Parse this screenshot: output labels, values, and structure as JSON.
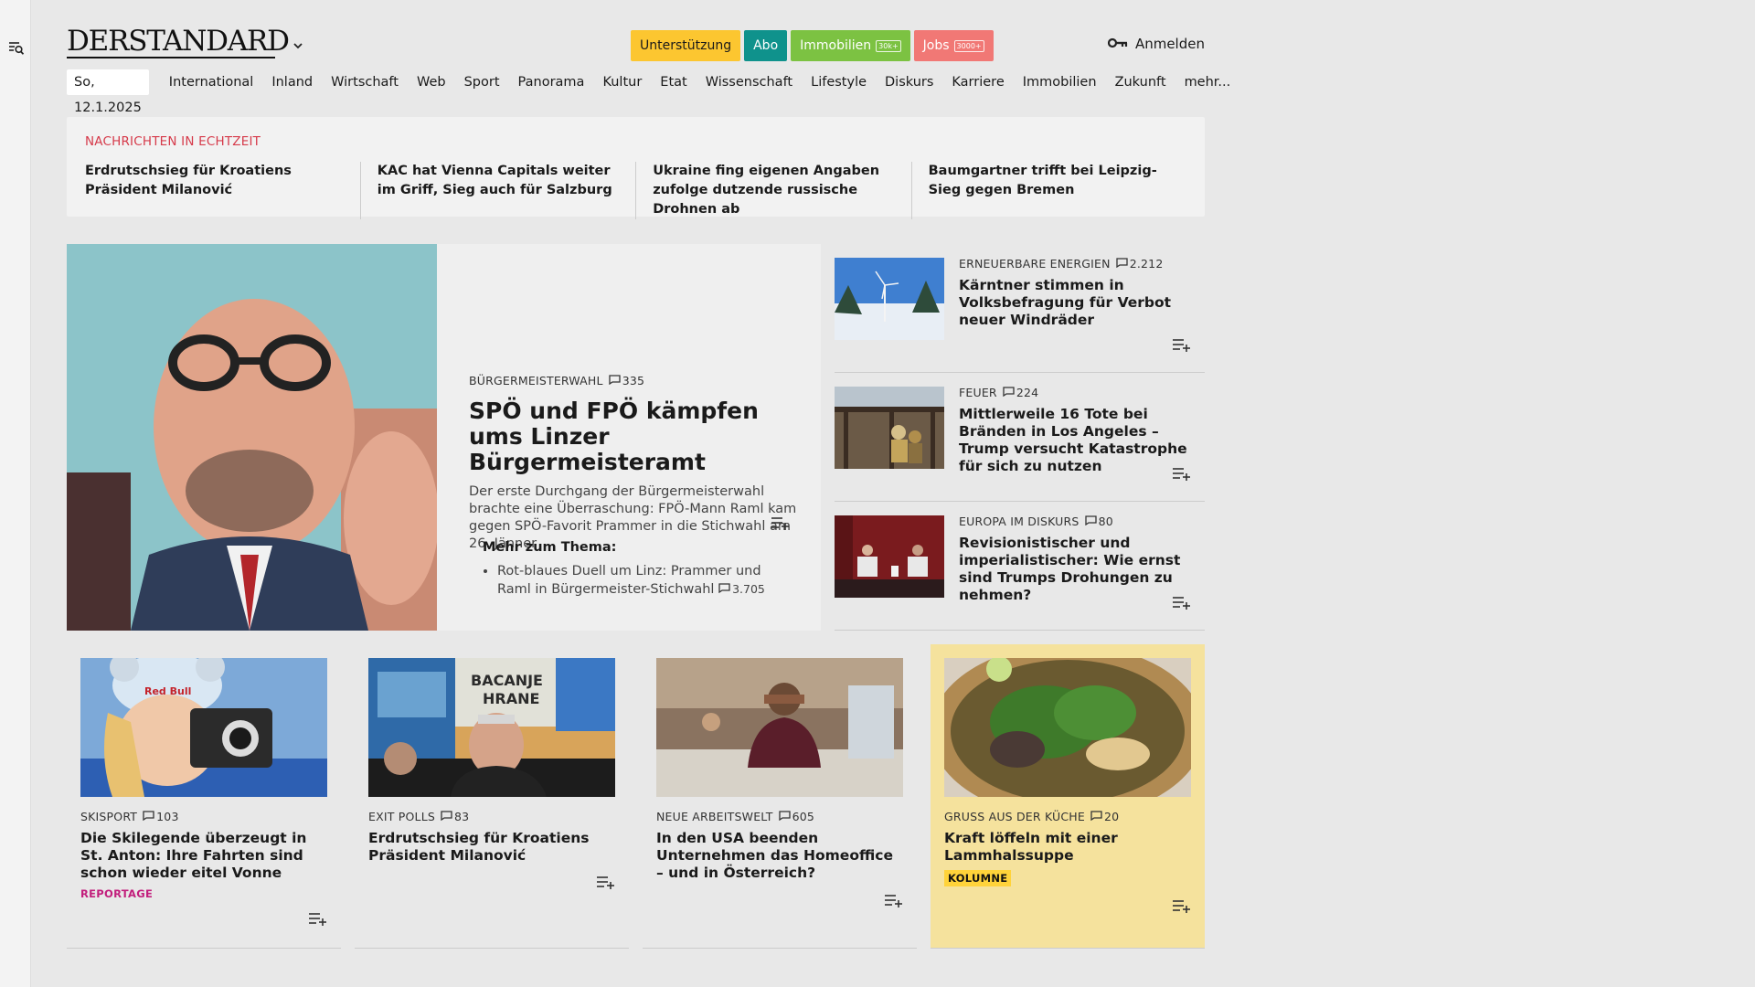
{
  "header": {
    "logo": "DERSTANDARD",
    "promos": [
      {
        "label": "Unterstützung",
        "tag": "",
        "color": "#fcc630",
        "text_color": "#1a1a1a"
      },
      {
        "label": "Abo",
        "tag": "",
        "color": "#0f928c",
        "text_color": "#ffffff"
      },
      {
        "label": "Immobilien",
        "tag": "30k+",
        "color": "#7cc242",
        "text_color": "#ffffff"
      },
      {
        "label": "Jobs",
        "tag": "3000+",
        "color": "#f17875",
        "text_color": "#ffffff"
      }
    ],
    "login_label": "Anmelden"
  },
  "nav": {
    "date": "So, 12.1.2025",
    "items": [
      "International",
      "Inland",
      "Wirtschaft",
      "Web",
      "Sport",
      "Panorama",
      "Kultur",
      "Etat",
      "Wissenschaft",
      "Lifestyle",
      "Diskurs",
      "Karriere",
      "Immobilien",
      "Zukunft",
      "mehr..."
    ]
  },
  "ticker": {
    "label": "NACHRICHTEN IN ECHTZEIT",
    "items": [
      "Erdrutschsieg für Kroatiens Präsident Milanović",
      "KAC hat Vienna Capitals weiter im Griff, Sieg auch für Salzburg",
      "Ukraine fing eigenen Angaben zu­folge dutzende russische Drohnen ab",
      "Baumgartner trifft bei Leipzig-Sieg gegen Bremen"
    ]
  },
  "hero": {
    "kicker": "Bürgermeisterwahl",
    "comments": "335",
    "title": "SPÖ und FPÖ kämpfen ums Linzer Bürgermeisteramt",
    "lead": "Der erste Durchgang der Bürgermeisterwahl brachte eine Überraschung: FPÖ-Mann Raml kam gegen SPÖ-Favorit Prammer in die Stichwahl am 26. Jänner",
    "more_title": "Mehr zum Thema:",
    "more_item": "Rot-blaues Duell um Linz: Prammer und Raml in Bürgermeister-Stichwahl",
    "more_comments": "3.705"
  },
  "side": [
    {
      "kicker": "Erneuerbare Energien",
      "comments": "2.212",
      "title": "Kärntner stimmen in Volksbefragung für Verbot neuer Windräder"
    },
    {
      "kicker": "Feuer",
      "comments": "224",
      "title": "Mittlerweile 16 Tote bei Bränden in Los Angeles – Trump versucht Katastrophe für sich zu nutzen"
    },
    {
      "kicker": "Europa im Diskurs",
      "comments": "80",
      "title": "Revisionistischer und imperialis­tischer: Wie ernst sind Trumps Drohungen zu nehmen?"
    }
  ],
  "cards": [
    {
      "kicker": "Skisport",
      "comments": "103",
      "title": "Die Skilegende überzeugt in St. Anton: Ihre Fahrten sind schon wieder eitel Vonne",
      "badge": "REPORTAGE"
    },
    {
      "kicker": "Exit Polls",
      "comments": "83",
      "title": "Erdrutschsieg für Kroatiens Präsident Milanović",
      "badge": ""
    },
    {
      "kicker": "Neue Arbeitswelt",
      "comments": "605",
      "title": "In den USA beenden Unternehmen das Homeoffice – und in Österreich?",
      "badge": ""
    },
    {
      "kicker": "Gruß aus der Küche",
      "comments": "20",
      "title": "Kraft löffeln mit einer Lammhalssuppe",
      "badge": "KOLUMNE"
    }
  ],
  "colors": {
    "ticker_label": "#d63a4a",
    "reportage": "#c21e7c",
    "kolumne_bg": "#ffd33a",
    "card_highlight": "#f5e29d"
  }
}
